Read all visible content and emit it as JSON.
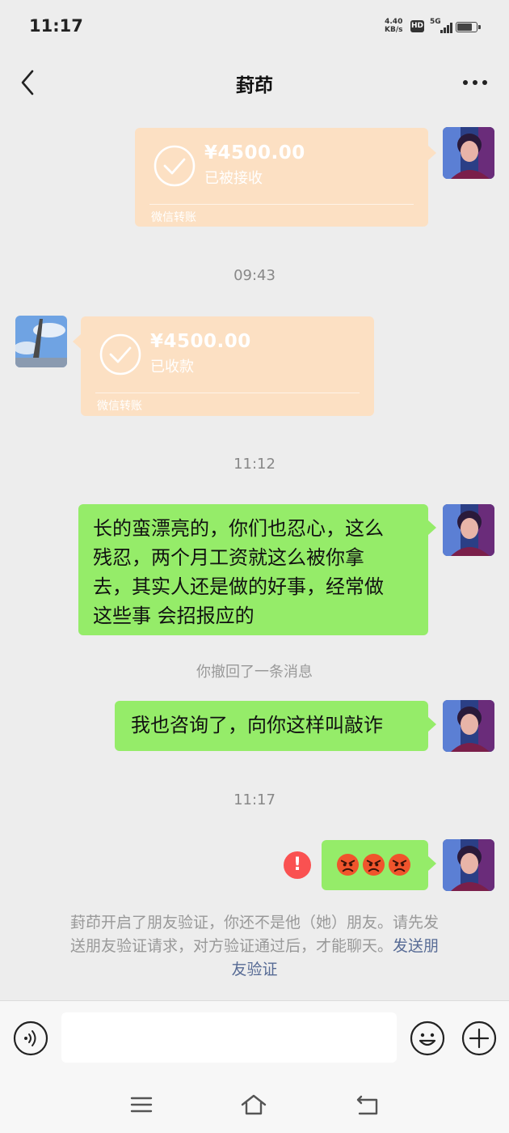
{
  "status_bar": {
    "time": "11:17",
    "net_speed_value": "4.40",
    "net_speed_unit": "KB/s",
    "hd_badge": "HD",
    "network": "5G",
    "battery_level": 0.7
  },
  "header": {
    "title": "葑茚",
    "back_icon": "chevron-left-icon",
    "more_icon": "more-dots-icon"
  },
  "messages": {
    "transfer_sent": {
      "amount": "¥4500.00",
      "status": "已被接收",
      "footer": "微信转账"
    },
    "time_1": "09:43",
    "transfer_received": {
      "amount": "¥4500.00",
      "status": "已收款",
      "footer": "微信转账"
    },
    "time_2": "11:12",
    "text_1_lines": [
      "长的蛮漂亮的，你们也忍心，这么",
      "残忍，两个月工资就这么被你拿",
      "去，其实人还是做的好事，经常做",
      "这些事 会招报应的"
    ],
    "recall_notice": "你撤回了一条消息",
    "text_2": "我也咨询了，向你这样叫敲诈",
    "time_3": "11:17",
    "failed_icon": "!",
    "emoji_message": "angry-face-emoji x3"
  },
  "verify_notice": {
    "line_1": "葑茚开启了朋友验证，你还不是他（她）朋友。请先发",
    "line_2_text": "送朋友验证请求，对方验证通过后，才能聊天。",
    "line_2_link": "发送朋",
    "line_3_link": "友验证"
  },
  "input_bar": {
    "placeholder": "",
    "voice_icon": "voice-icon",
    "emoji_icon": "emoji-icon",
    "plus_icon": "plus-icon"
  },
  "colors": {
    "background": "#ededed",
    "bubble_green": "#95ec69",
    "transfer_orange": "#fce0c3",
    "link_blue": "#576b95",
    "error_red": "#fa5151"
  }
}
